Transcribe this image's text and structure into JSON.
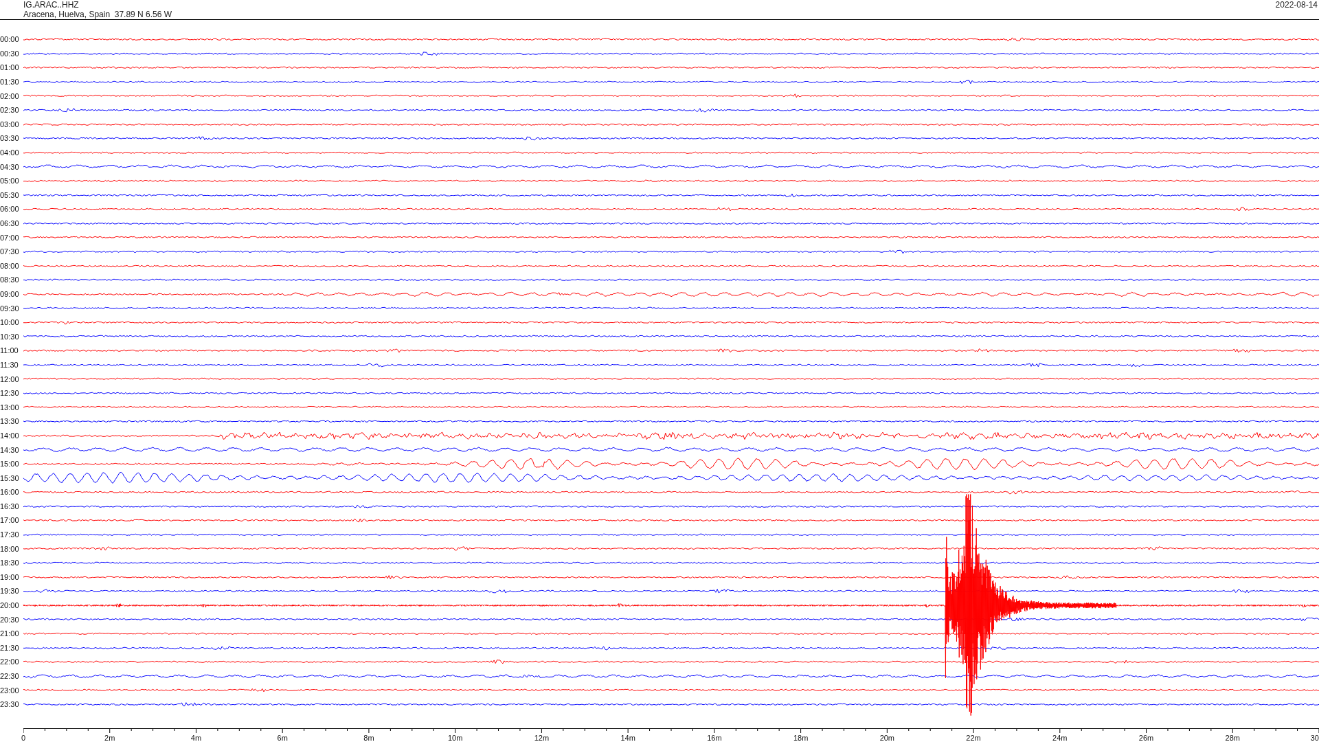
{
  "header": {
    "station": "IG.ARAC..HHZ",
    "location": "Aracena, Huelva, Spain  37.89 N 6.56 W",
    "date": "2022-08-14"
  },
  "rows": [
    {
      "time": "00:00",
      "color": "#ff0000"
    },
    {
      "time": "00:30",
      "color": "#0000ff"
    },
    {
      "time": "01:00",
      "color": "#ff0000"
    },
    {
      "time": "01:30",
      "color": "#0000ff"
    },
    {
      "time": "02:00",
      "color": "#ff0000"
    },
    {
      "time": "02:30",
      "color": "#0000ff"
    },
    {
      "time": "03:00",
      "color": "#ff0000"
    },
    {
      "time": "03:30",
      "color": "#0000ff"
    },
    {
      "time": "04:00",
      "color": "#ff0000"
    },
    {
      "time": "04:30",
      "color": "#0000ff"
    },
    {
      "time": "05:00",
      "color": "#ff0000"
    },
    {
      "time": "05:30",
      "color": "#0000ff"
    },
    {
      "time": "06:00",
      "color": "#ff0000"
    },
    {
      "time": "06:30",
      "color": "#0000ff"
    },
    {
      "time": "07:00",
      "color": "#ff0000"
    },
    {
      "time": "07:30",
      "color": "#0000ff"
    },
    {
      "time": "08:00",
      "color": "#ff0000"
    },
    {
      "time": "08:30",
      "color": "#0000ff"
    },
    {
      "time": "09:00",
      "color": "#ff0000"
    },
    {
      "time": "09:30",
      "color": "#0000ff"
    },
    {
      "time": "10:00",
      "color": "#ff0000"
    },
    {
      "time": "10:30",
      "color": "#0000ff"
    },
    {
      "time": "11:00",
      "color": "#ff0000"
    },
    {
      "time": "11:30",
      "color": "#0000ff"
    },
    {
      "time": "12:00",
      "color": "#ff0000"
    },
    {
      "time": "12:30",
      "color": "#0000ff"
    },
    {
      "time": "13:00",
      "color": "#ff0000"
    },
    {
      "time": "13:30",
      "color": "#0000ff"
    },
    {
      "time": "14:00",
      "color": "#ff0000"
    },
    {
      "time": "14:30",
      "color": "#0000ff"
    },
    {
      "time": "15:00",
      "color": "#ff0000"
    },
    {
      "time": "15:30",
      "color": "#0000ff"
    },
    {
      "time": "16:00",
      "color": "#ff0000"
    },
    {
      "time": "16:30",
      "color": "#0000ff"
    },
    {
      "time": "17:00",
      "color": "#ff0000"
    },
    {
      "time": "17:30",
      "color": "#0000ff"
    },
    {
      "time": "18:00",
      "color": "#ff0000"
    },
    {
      "time": "18:30",
      "color": "#0000ff"
    },
    {
      "time": "19:00",
      "color": "#ff0000"
    },
    {
      "time": "19:30",
      "color": "#0000ff"
    },
    {
      "time": "20:00",
      "color": "#ff0000"
    },
    {
      "time": "20:30",
      "color": "#0000ff"
    },
    {
      "time": "21:00",
      "color": "#ff0000"
    },
    {
      "time": "21:30",
      "color": "#0000ff"
    },
    {
      "time": "22:00",
      "color": "#ff0000"
    },
    {
      "time": "22:30",
      "color": "#0000ff"
    },
    {
      "time": "23:00",
      "color": "#ff0000"
    },
    {
      "time": "23:30",
      "color": "#0000ff"
    }
  ],
  "time_axis": {
    "labels": [
      "0",
      "2m",
      "4m",
      "6m",
      "8m",
      "10m",
      "12m",
      "14m",
      "16m",
      "18m",
      "20m",
      "22m",
      "24m",
      "26m",
      "28m",
      "30"
    ]
  }
}
